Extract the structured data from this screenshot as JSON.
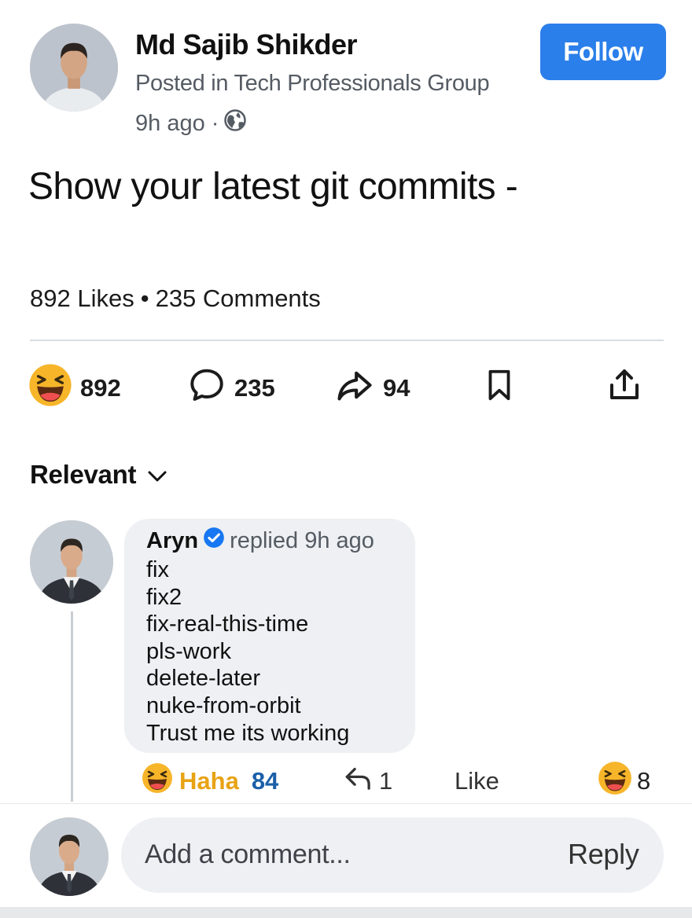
{
  "post": {
    "author": "Md Sajib Shikder",
    "posted_in": "Posted in Tech Professionals Group",
    "time": "9h ago ·",
    "follow_label": "Follow",
    "text": "Show your latest git commits -",
    "stats": {
      "likes": "892 Likes",
      "separator": "•",
      "comments": "235 Comments"
    }
  },
  "actions": {
    "reactions": {
      "icon": "laughing-emoji-icon",
      "count": "892"
    },
    "comments": {
      "icon": "speech-bubble-icon",
      "count": "235"
    },
    "shares": {
      "icon": "share-arrow-icon",
      "count": "94"
    },
    "save": {
      "icon": "bookmark-icon"
    },
    "upload": {
      "icon": "upload-icon"
    }
  },
  "sort": {
    "label": "Relevant"
  },
  "comment": {
    "author": "Aryn",
    "meta": "replied 9h ago",
    "lines": [
      "fix",
      "fix2",
      "fix-real-this-time",
      "pls-work",
      "delete-later",
      "nuke-from-orbit",
      "Trust me its working"
    ],
    "reaction_label": "Haha",
    "reaction_count": "84",
    "replies_count": "1",
    "like_label": "Like",
    "emoji_count": "8"
  },
  "composer": {
    "placeholder": "Add a comment...",
    "reply_label": "Reply"
  },
  "colors": {
    "accent": "#2b7fea",
    "haha": "#e8a315",
    "verified": "#1877f2",
    "count_blue": "#1a5fa8"
  }
}
